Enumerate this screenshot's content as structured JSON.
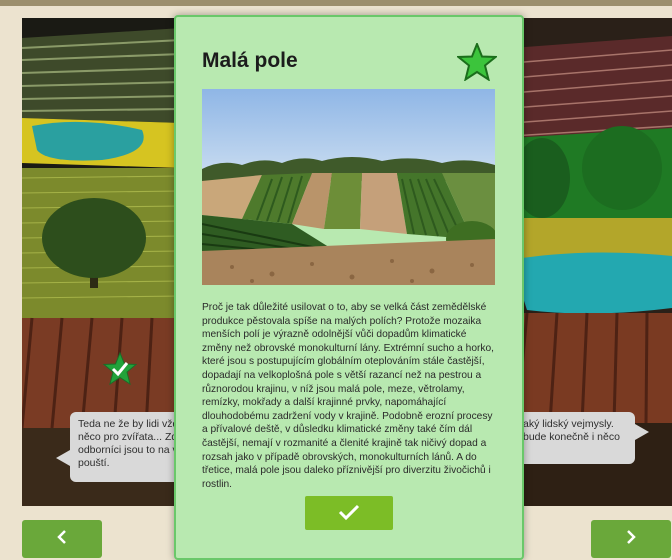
{
  "modal": {
    "title": "Malá pole",
    "body": "Proč je tak důležité usilovat o to, aby se velká část zemědělské produkce pěstovala spíše na malých polích? Protože mozaika menších polí je výrazně odolnější vůči dopadům klimatické změny než obrovské monokulturní lány. Extrémní sucho a horko, které jsou s postupujícím globálním oteplováním stále častější, dopadají na velkoplošná pole s větší razancí než na pestrou a různorodou krajinu, v níž jsou malá pole, meze, větrolamy, remízky, mokřady a další krajinné prvky, napomáhající dlouhodobému zadržení vody v krajině. Podobně erozní procesy a přívalové deště, v důsledku klimatické změny také čím dál častější, nemají v rozmanité a členité krajině tak ničivý dopad a rozsah jako v případě obrovských, monokulturních lánů. A do třetice, malá pole jsou daleko příznivější pro diverzitu živočichů i rostlin.",
    "star_icon": "star-icon",
    "confirm_icon": "checkmark-icon"
  },
  "bubbles": {
    "left": "Teda ne že by lidi vždyc něco pro zvířata... Zdale odborníci jsou to na vyt pouští.",
    "right": "aký lidský vejmysly. bude konečně i něco"
  },
  "navigation": {
    "prev_icon": "chevron-left-icon",
    "next_icon": "chevron-right-icon"
  },
  "colors": {
    "modal_bg": "#b8e9b0",
    "modal_border": "#6ac86a",
    "confirm_button": "#7cbd26",
    "nav_button": "#6aa83a",
    "star": "#3cc43c"
  }
}
